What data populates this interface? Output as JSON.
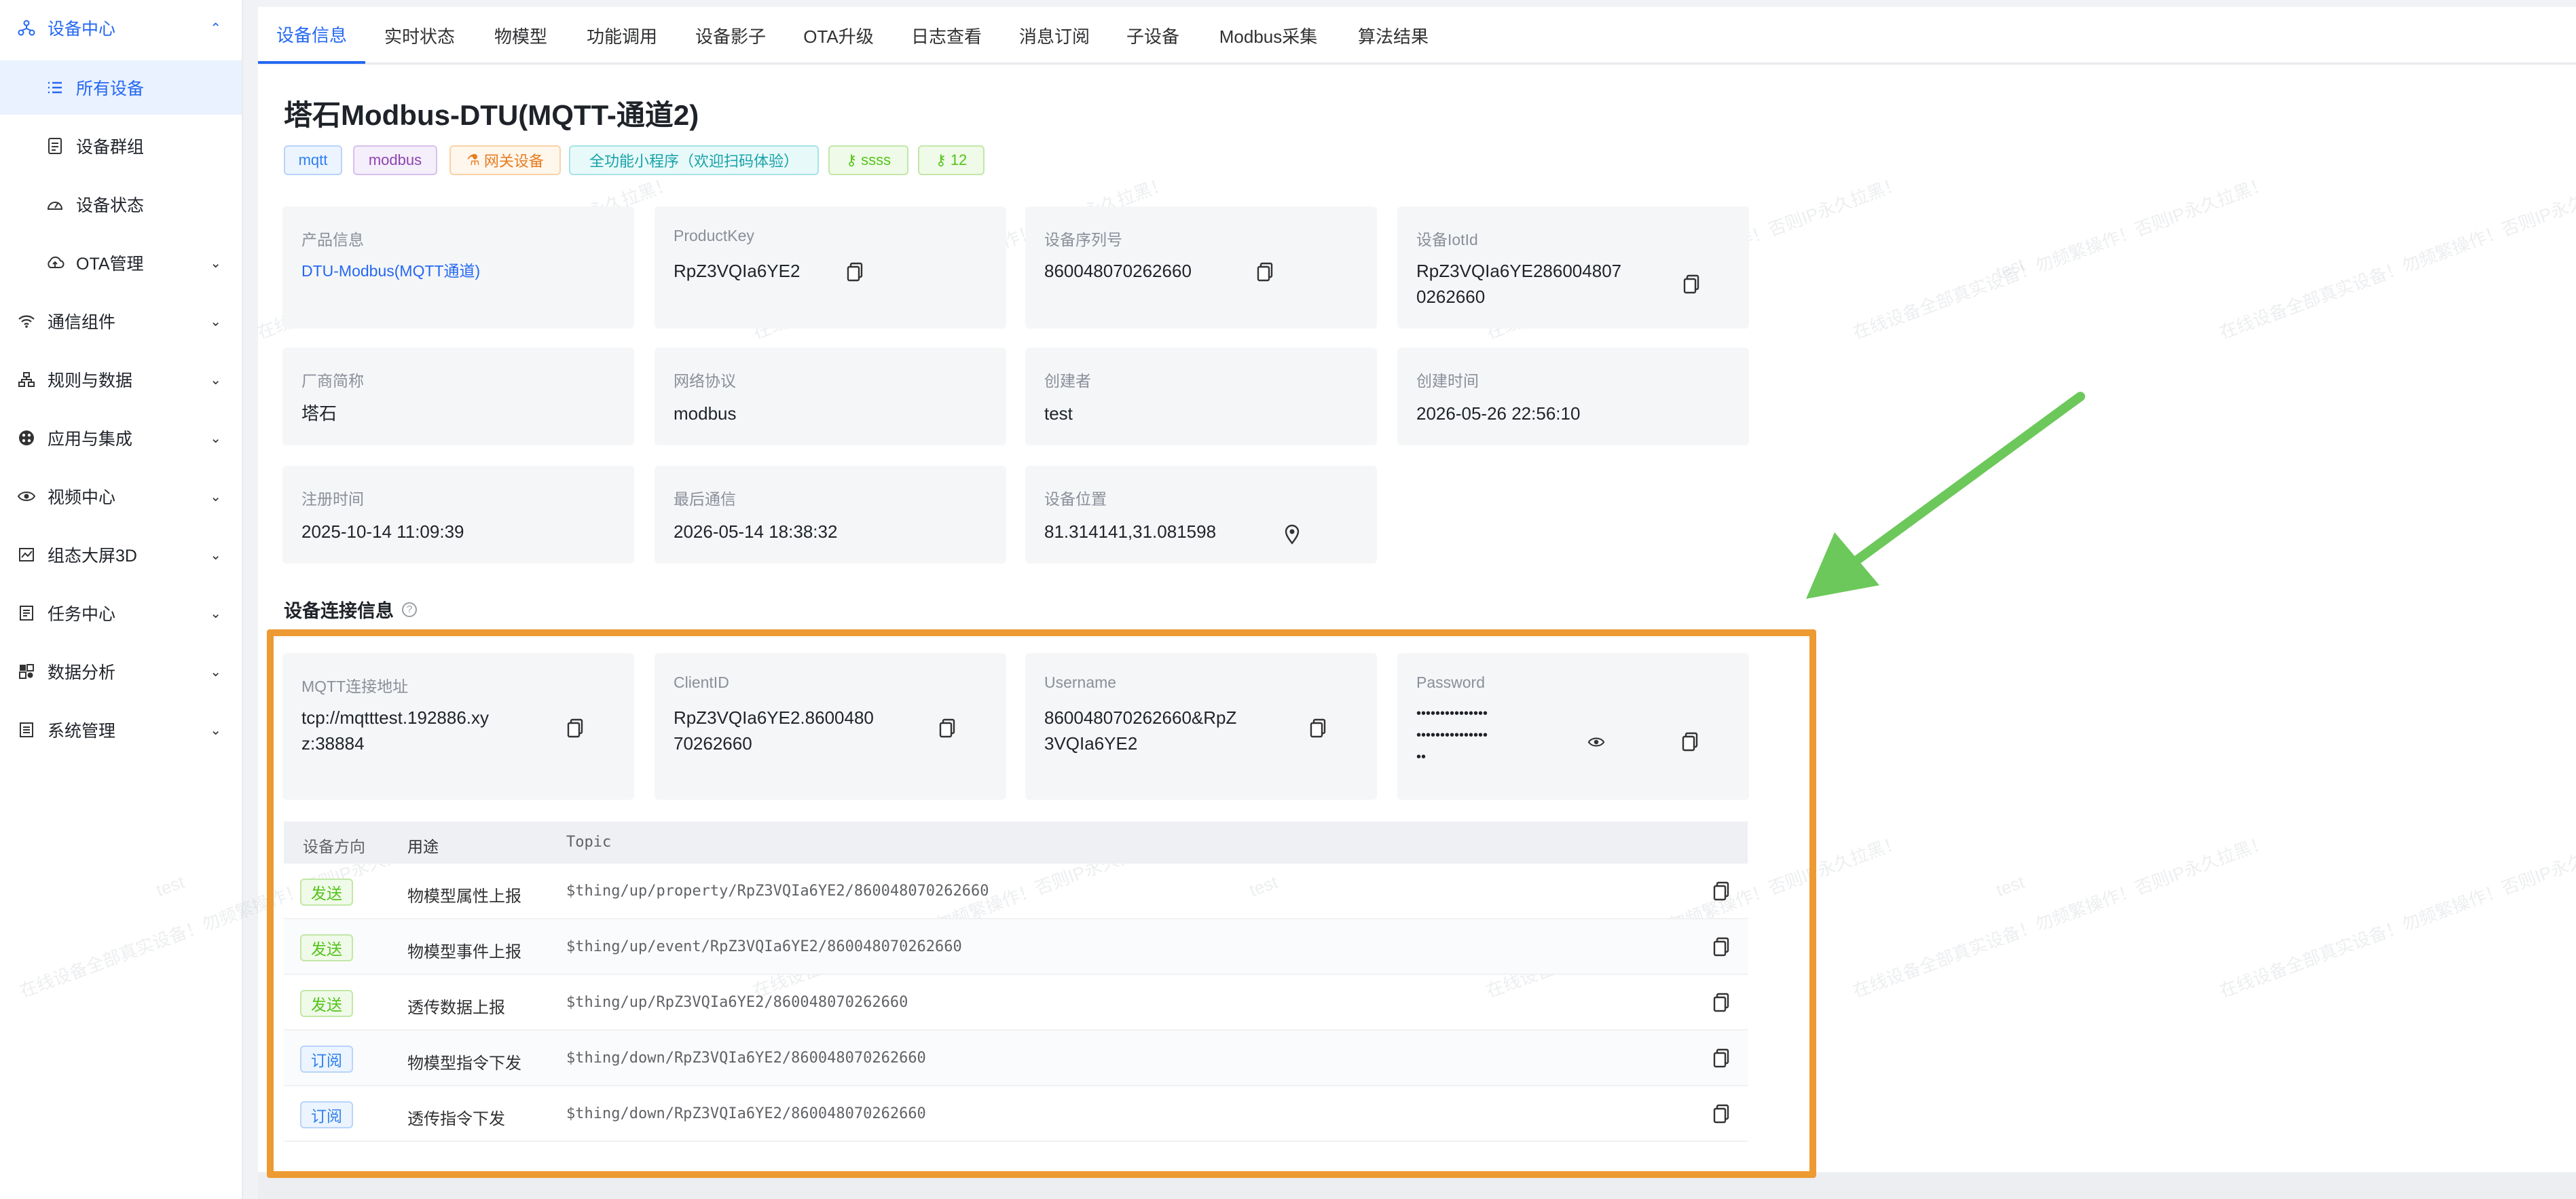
{
  "sidebar": {
    "device_center": "设备中心",
    "all_devices": "所有设备",
    "device_groups": "设备群组",
    "device_status": "设备状态",
    "ota_manage": "OTA管理",
    "comm_components": "通信组件",
    "rules_data": "规则与数据",
    "apps_integration": "应用与集成",
    "video_center": "视频中心",
    "dashboard_3d": "组态大屏3D",
    "task_center": "任务中心",
    "data_analysis": "数据分析",
    "system_manage": "系统管理"
  },
  "tabs": [
    "设备信息",
    "实时状态",
    "物模型",
    "功能调用",
    "设备影子",
    "OTA升级",
    "日志查看",
    "消息订阅",
    "子设备",
    "Modbus采集",
    "算法结果"
  ],
  "device": {
    "title": "塔石Modbus-DTU(MQTT-通道2)",
    "tags": [
      "mqtt",
      "modbus",
      "网关设备",
      "全功能小程序（欢迎扫码体验）",
      "ssss",
      "12"
    ]
  },
  "info": {
    "product_label": "产品信息",
    "product_value": "DTU-Modbus(MQTT通道)",
    "productkey_label": "ProductKey",
    "productkey_value": "RpZ3VQIa6YE2",
    "serial_label": "设备序列号",
    "serial_value": "860048070262660",
    "iotid_label": "设备IotId",
    "iotid_line1": "RpZ3VQIa6YE286004807",
    "iotid_line2": "0262660",
    "vendor_label": "厂商简称",
    "vendor_value": "塔石",
    "protocol_label": "网络协议",
    "protocol_value": "modbus",
    "creator_label": "创建者",
    "creator_value": "test",
    "created_label": "创建时间",
    "created_value": "2026-05-26 22:56:10",
    "registered_label": "注册时间",
    "registered_value": "2025-10-14 11:09:39",
    "lastcomm_label": "最后通信",
    "lastcomm_value": "2026-05-14 18:38:32",
    "location_label": "设备位置",
    "location_value": "81.314141,31.081598"
  },
  "conn": {
    "section_title": "设备连接信息",
    "mqtt_label": "MQTT连接地址",
    "mqtt_line1": "tcp://mqtttest.192886.xy",
    "mqtt_line2": "z:38884",
    "client_label": "ClientID",
    "client_line1": "RpZ3VQIa6YE2.8600480",
    "client_line2": "70262660",
    "user_label": "Username",
    "user_line1": "860048070262660&RpZ",
    "user_line2": "3VQIa6YE2",
    "pass_label": "Password",
    "pass_line1": "•••••••••••••••",
    "pass_line2": "•••••••••••••••",
    "pass_line3": "••"
  },
  "topics": {
    "headers": [
      "设备方向",
      "用途",
      "Topic"
    ],
    "rows": [
      {
        "dir": "发送",
        "use": "物模型属性上报",
        "topic": "$thing/up/property/RpZ3VQIa6YE2/860048070262660"
      },
      {
        "dir": "发送",
        "use": "物模型事件上报",
        "topic": "$thing/up/event/RpZ3VQIa6YE2/860048070262660"
      },
      {
        "dir": "发送",
        "use": "透传数据上报",
        "topic": "$thing/up/RpZ3VQIa6YE2/860048070262660"
      },
      {
        "dir": "订阅",
        "use": "物模型指令下发",
        "topic": "$thing/down/RpZ3VQIa6YE2/860048070262660"
      },
      {
        "dir": "订阅",
        "use": "透传指令下发",
        "topic": "$thing/down/RpZ3VQIa6YE2/860048070262660"
      }
    ]
  },
  "watermark": {
    "user": "test",
    "notice": "在线设备全部真实设备！勿频繁操作！否则IP永久拉黑！"
  },
  "colors": {
    "primary": "#2468f2",
    "highlight_box": "#ed9a32",
    "arrow": "#6cc85a",
    "send_tag": "#52c41a",
    "subscribe_tag": "#2f80ed"
  }
}
